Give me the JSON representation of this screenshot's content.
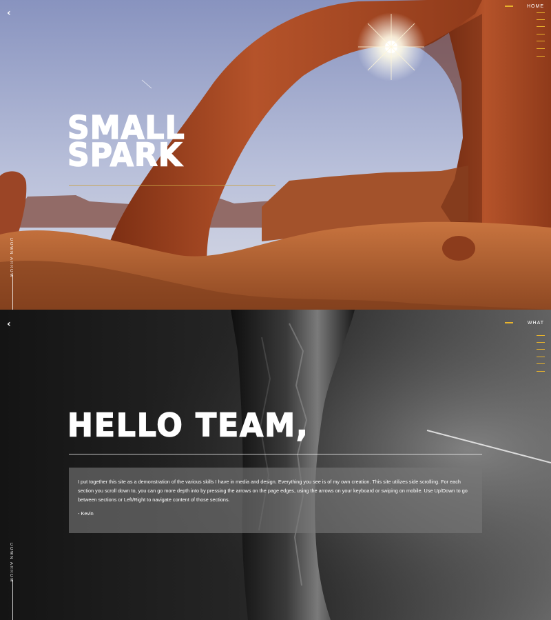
{
  "sections": [
    {
      "id": "home",
      "nav_label": "HOME",
      "title_line1": "SMALL",
      "title_line2": "SPARK",
      "side_label": "DOWN ARROW"
    },
    {
      "id": "what",
      "nav_label": "WHAT",
      "title": "HELLO TEAM,",
      "message": "I put together this site as a demonstration of the various skills I have in media and design. Everything you see is of my own creation. This site utilizes side scrolling. For each section you scroll down to, you can go more depth into by pressing the arrows on the page edges, using the arrows on your keyboard or swiping on mobile. Use Up/Down to go between sections or Left/Right to navigate content of those sections.",
      "signature": "- Kevin",
      "side_label": "DOWN ARROW"
    }
  ],
  "icons": {
    "back": "left-chevron-icon"
  },
  "colors": {
    "accent": "#e8b32c",
    "sky": "#9aa4c4",
    "rock": "#b24a22",
    "dark_bg": "#1c1c1c"
  }
}
